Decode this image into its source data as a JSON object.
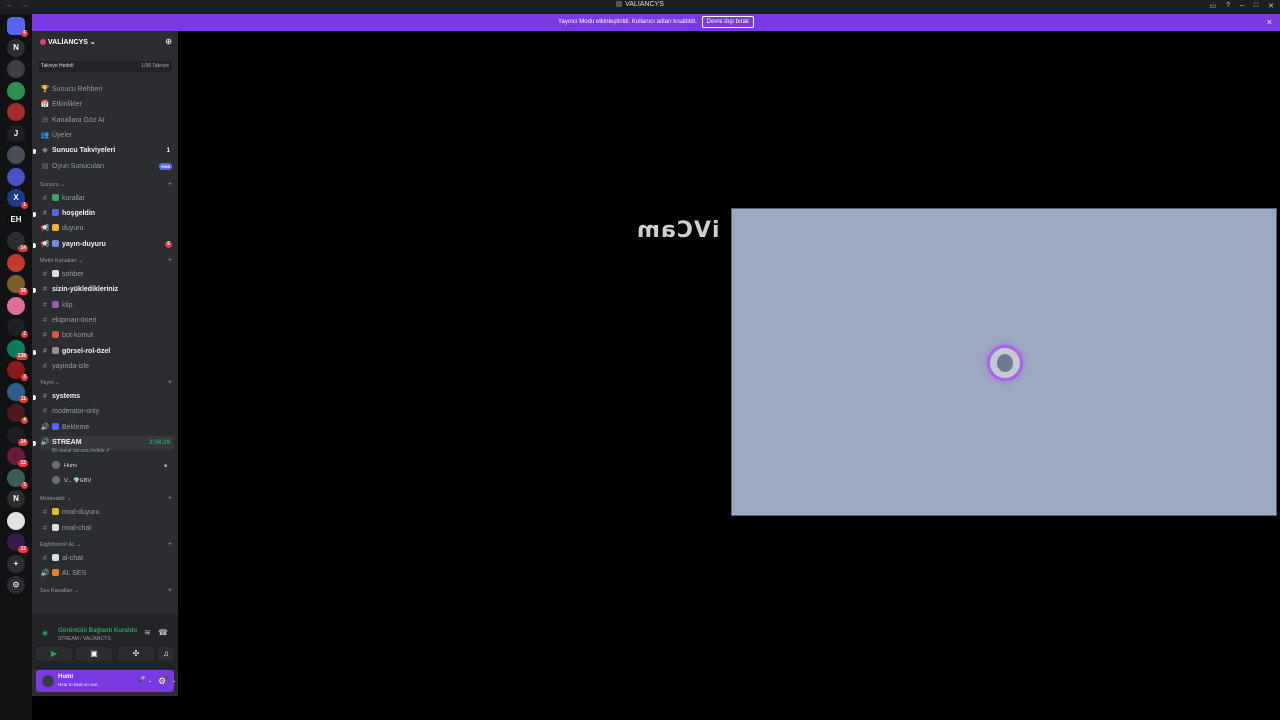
{
  "window": {
    "title": "VALİANCYS",
    "nav": "← →"
  },
  "banner": {
    "text": "Yayıncı Modu etkinleştirildi. Kullanıcı adları kısaltıldı.",
    "button": "Devre dışı bırak",
    "close": "×"
  },
  "guilds": [
    {
      "label": "",
      "color": "#5865f2",
      "badge": "6"
    },
    {
      "label": "N",
      "color": "#2b2d31",
      "badge": ""
    },
    {
      "label": "",
      "color": "#3d3f45",
      "badge": ""
    },
    {
      "label": "",
      "color": "#2f8f4e",
      "badge": ""
    },
    {
      "label": "",
      "color": "#a12a2a",
      "badge": ""
    },
    {
      "label": "J",
      "color": "#1e1f22",
      "badge": ""
    },
    {
      "label": "",
      "color": "#4a4d55",
      "badge": ""
    },
    {
      "label": "",
      "color": "#4752c4",
      "badge": ""
    },
    {
      "label": "X",
      "color": "#1e3a8a",
      "badge": "1"
    },
    {
      "label": "EH",
      "color": "#111",
      "badge": ""
    },
    {
      "label": "",
      "color": "#2b2d31",
      "badge": "14"
    },
    {
      "label": "",
      "color": "#c0392b",
      "badge": ""
    },
    {
      "label": "",
      "color": "#7a5c2e",
      "badge": "38"
    },
    {
      "label": "",
      "color": "#e06d9a",
      "badge": ""
    },
    {
      "label": "",
      "color": "#1e1f22",
      "badge": "2"
    },
    {
      "label": "",
      "color": "#0e7a5e",
      "badge": "138"
    },
    {
      "label": "",
      "color": "#8b1a1a",
      "badge": "3"
    },
    {
      "label": "",
      "color": "#2e5f8a",
      "badge": "11"
    },
    {
      "label": "",
      "color": "#4a1a1a",
      "badge": "4"
    },
    {
      "label": "",
      "color": "#1e1f22",
      "badge": "24"
    },
    {
      "label": "",
      "color": "#6b1a3a",
      "badge": "12"
    },
    {
      "label": "",
      "color": "#3a5f5a",
      "badge": "3"
    },
    {
      "label": "N",
      "color": "#2b2d31",
      "badge": ""
    },
    {
      "label": "",
      "color": "#e0e0e0",
      "badge": ""
    },
    {
      "label": "",
      "color": "#3a1a4a",
      "badge": "12"
    },
    {
      "label": "+",
      "color": "#2b2d31",
      "badge": ""
    },
    {
      "label": "⊙",
      "color": "#2b2d31",
      "badge": ""
    }
  ],
  "server": {
    "name": "VALİANCYS",
    "chevron": "⌄",
    "boost_goal": "Takviye Hedefi",
    "boost_progress": "1/36 Takviye"
  },
  "menu": [
    {
      "icon": "🏆",
      "label": "Sunucu Rehberi",
      "unread": false
    },
    {
      "icon": "📅",
      "label": "Etkinlikler",
      "unread": false
    },
    {
      "icon": "⊟",
      "label": "Kanallara Göz At",
      "unread": false
    },
    {
      "icon": "👥",
      "label": "Üyeler",
      "unread": false
    },
    {
      "icon": "◈",
      "label": "Sunucu Takviyeleri",
      "unread": true,
      "count": "1"
    },
    {
      "icon": "▤",
      "label": "Oyun Sunucuları",
      "unread": false,
      "new": "YENİ"
    }
  ],
  "categories": [
    {
      "name": "Sunucu",
      "channels": [
        {
          "type": "#",
          "emoji": "#3ba55c",
          "name": "kurallar",
          "unread": false
        },
        {
          "type": "#",
          "emoji": "#5865f2",
          "name": "hoşgeldin",
          "unread": true
        },
        {
          "type": "📢",
          "emoji": "#f0b232",
          "name": "duyuru",
          "unread": false
        },
        {
          "type": "📢",
          "emoji": "#7289da",
          "name": "yayın-duyuru",
          "unread": true,
          "badge": "6"
        }
      ]
    },
    {
      "name": "Metin Kanalları",
      "channels": [
        {
          "type": "#",
          "emoji": "#dbdee1",
          "name": "sohbet",
          "unread": false
        },
        {
          "type": "#",
          "emoji": "",
          "name": "sizin-yükledikleriniz",
          "unread": true
        },
        {
          "type": "#",
          "emoji": "#9b59b6",
          "name": "klip",
          "unread": false
        },
        {
          "type": "#",
          "emoji": "",
          "name": "ekipman-öneri",
          "unread": false
        },
        {
          "type": "#",
          "emoji": "#e74c3c",
          "name": "bot-komut",
          "unread": false
        },
        {
          "type": "#",
          "emoji": "#8e9297",
          "name": "görsel-rol-özel",
          "unread": true
        },
        {
          "type": "#",
          "emoji": "",
          "name": "yayinda-izle",
          "unread": false
        }
      ]
    },
    {
      "name": "Yayın",
      "channels": [
        {
          "type": "#",
          "emoji": "",
          "name": "systems",
          "unread": true
        },
        {
          "type": "#",
          "emoji": "",
          "name": "moderator-only",
          "unread": false
        },
        {
          "type": "🔊",
          "emoji": "#5865f2",
          "name": "Bekleme",
          "unread": false
        },
        {
          "type": "🔊",
          "emoji": "",
          "name": "STREAM",
          "unread": true,
          "time": "2:56:29"
        }
      ]
    },
    {
      "name": "Moderatör",
      "channels": [
        {
          "type": "#",
          "emoji": "#f0b232",
          "name": "mod-duyuru",
          "unread": false
        },
        {
          "type": "#",
          "emoji": "#dbdee1",
          "name": "mod-chat",
          "unread": false
        }
      ]
    },
    {
      "name": "EightbornV AL",
      "channels": [
        {
          "type": "#",
          "emoji": "#dbdee1",
          "name": "al-chat",
          "unread": false
        },
        {
          "type": "🔊",
          "emoji": "#e67e22",
          "name": "AL SES",
          "unread": false
        }
      ]
    },
    {
      "name": "Ses Kanalları",
      "channels": []
    }
  ],
  "voice": {
    "status_hint": "Bir kanal durumu belirle ✐",
    "users": [
      {
        "name": "Humi"
      },
      {
        "name": "V... 💎EBV"
      }
    ]
  },
  "rtc": {
    "status": "Görüntülü Bağlantı Kuruldu",
    "channel": "STREAM / VALİANCYS"
  },
  "user": {
    "name": "Humi",
    "status": "Hear to beat so one."
  },
  "stage": {
    "watermark": "iVCam"
  }
}
